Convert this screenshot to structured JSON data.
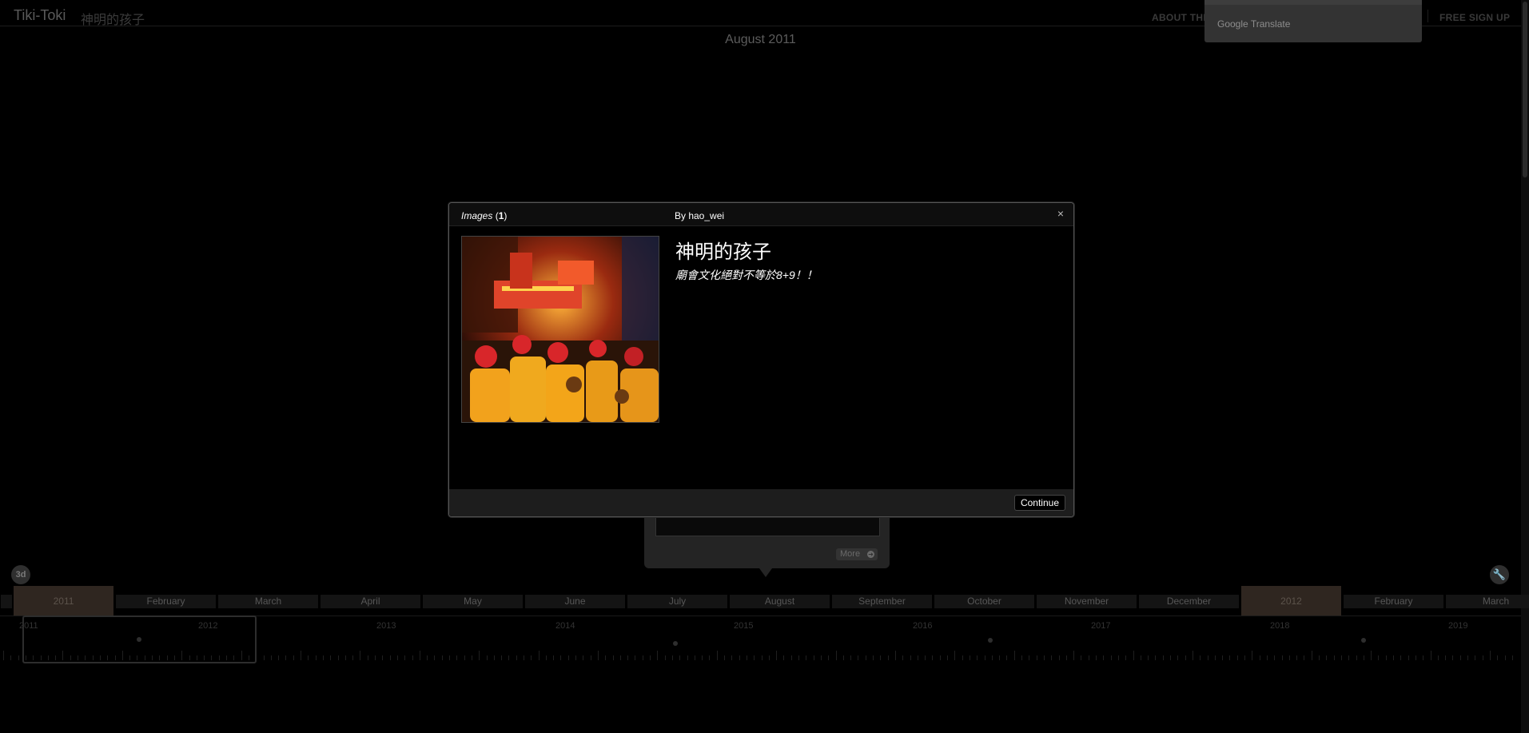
{
  "header": {
    "logo": "Tiki-Toki",
    "timeline_title": "神明的孩子",
    "about_label": "ABOUT THI",
    "signup_label": "FREE SIGN UP"
  },
  "google_translate": {
    "label": "Google Translate"
  },
  "current_date": "August 2011",
  "story_card": {
    "more_label": "More"
  },
  "controls": {
    "view_3d_label": "3d",
    "tools_icon": "wrench-icon"
  },
  "months": [
    {
      "label": "2011",
      "year": true
    },
    {
      "label": "February",
      "year": false
    },
    {
      "label": "March",
      "year": false
    },
    {
      "label": "April",
      "year": false
    },
    {
      "label": "May",
      "year": false
    },
    {
      "label": "June",
      "year": false
    },
    {
      "label": "July",
      "year": false
    },
    {
      "label": "August",
      "year": false
    },
    {
      "label": "September",
      "year": false
    },
    {
      "label": "October",
      "year": false
    },
    {
      "label": "November",
      "year": false
    },
    {
      "label": "December",
      "year": false
    },
    {
      "label": "2012",
      "year": true
    },
    {
      "label": "February",
      "year": false
    },
    {
      "label": "March",
      "year": false
    }
  ],
  "navigator_years": [
    "2011",
    "2012",
    "2013",
    "2014",
    "2015",
    "2016",
    "2017",
    "2018",
    "2019"
  ],
  "overlay": {
    "tab_label": "Images",
    "tab_count": "1",
    "author": "By hao_wei",
    "close_label": "×",
    "title": "神明的孩子",
    "body": "廟會文化絕對不等於8+9！！",
    "continue_label": "Continue",
    "image_icon": "photo-temple-festival"
  },
  "colors": {
    "background": "#000000",
    "year_highlight": "#2f2620",
    "overlay_border": "#555555"
  }
}
